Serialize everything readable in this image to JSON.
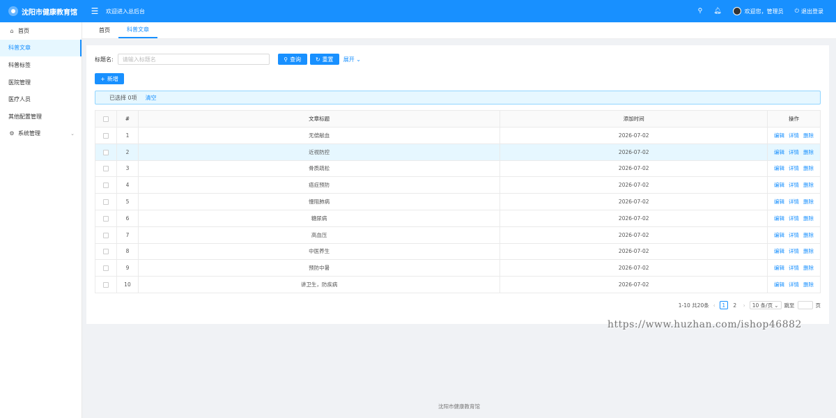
{
  "header": {
    "app_name": "沈阳市健康教育馆",
    "welcome": "欢迎进入总后台",
    "user_greeting": "欢迎您，管理员",
    "logout": "退出登录"
  },
  "sidebar": {
    "items": [
      {
        "label": "首页",
        "icon": "home-icon"
      },
      {
        "label": "科普文章"
      },
      {
        "label": "科普标签"
      },
      {
        "label": "医院管理"
      },
      {
        "label": "医疗人员"
      },
      {
        "label": "其他配置管理"
      },
      {
        "label": "系统管理",
        "icon": "gear-icon"
      }
    ]
  },
  "tabs": [
    {
      "label": "首页"
    },
    {
      "label": "科普文章"
    }
  ],
  "search": {
    "label": "标题名:",
    "placeholder": "请输入标题名",
    "query": "查询",
    "reset": "重置",
    "expand": "展开"
  },
  "toolbar": {
    "add": "新增"
  },
  "selection": {
    "text": "已选择 0项",
    "clear": "清空"
  },
  "table": {
    "headers": {
      "index": "#",
      "title": "文章标题",
      "time": "添加时间",
      "ops": "操作"
    },
    "ops": {
      "edit": "编辑",
      "detail": "详情",
      "delete": "删除"
    },
    "rows": [
      {
        "index": "1",
        "title": "无偿献血",
        "time": "2026-07-02"
      },
      {
        "index": "2",
        "title": "近视防控",
        "time": "2026-07-02"
      },
      {
        "index": "3",
        "title": "骨质疏松",
        "time": "2026-07-02"
      },
      {
        "index": "4",
        "title": "癌症预防",
        "time": "2026-07-02"
      },
      {
        "index": "5",
        "title": "慢阻肺病",
        "time": "2026-07-02"
      },
      {
        "index": "6",
        "title": "糖尿病",
        "time": "2026-07-02"
      },
      {
        "index": "7",
        "title": "高血压",
        "time": "2026-07-02"
      },
      {
        "index": "8",
        "title": "中医养生",
        "time": "2026-07-02"
      },
      {
        "index": "9",
        "title": "预防中暑",
        "time": "2026-07-02"
      },
      {
        "index": "10",
        "title": "讲卫生，防疾病",
        "time": "2026-07-02"
      }
    ]
  },
  "pagination": {
    "summary": "1-10 共20条",
    "pages": [
      "1",
      "2"
    ],
    "page_size": "10 条/页",
    "jump_label": "跳至",
    "page_unit": "页"
  },
  "watermark": "https://www.huzhan.com/ishop46882",
  "footer": "沈阳市健康教育馆",
  "colors": {
    "primary": "#1890ff",
    "highlight_row": "#e6f7ff"
  }
}
